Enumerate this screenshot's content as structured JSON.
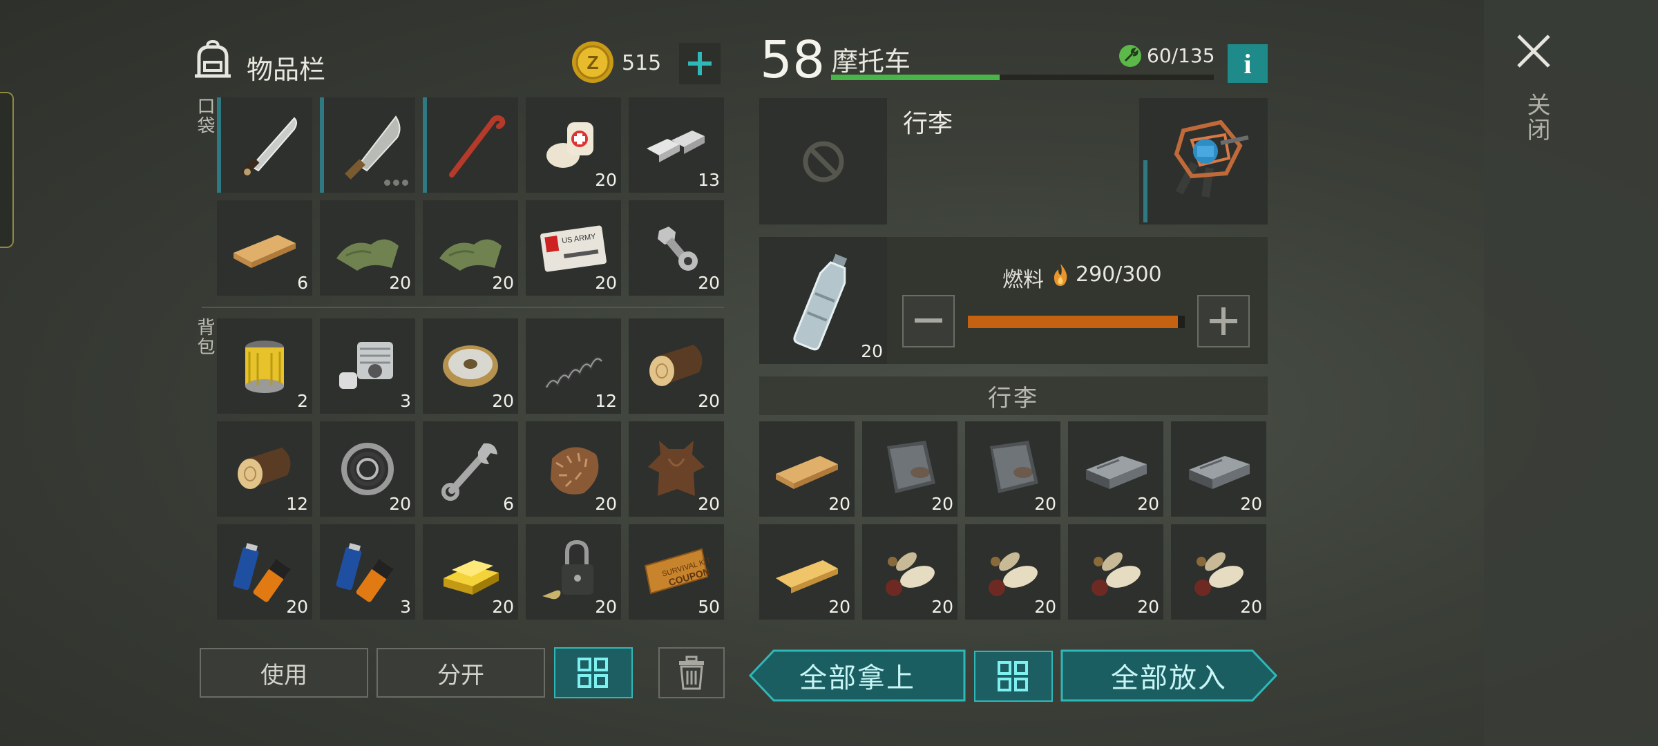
{
  "inventory": {
    "title": "物品栏",
    "coins": "515",
    "pockets_label": "口袋",
    "backpack_label": "背包",
    "pockets": [
      {
        "icon": "machete-icon",
        "count": "",
        "blue": true
      },
      {
        "icon": "broad-machete-icon",
        "count": "",
        "blue": true,
        "dots": true
      },
      {
        "icon": "crowbar-icon",
        "count": "",
        "blue": true
      },
      {
        "icon": "bandage-icon",
        "count": "20"
      },
      {
        "icon": "iron-bars-icon",
        "count": "13"
      },
      {
        "icon": "wooden-plank-icon",
        "count": "6"
      },
      {
        "icon": "cloth-icon",
        "count": "20"
      },
      {
        "icon": "cloth-icon",
        "count": "20"
      },
      {
        "icon": "us-army-card-icon",
        "count": "20"
      },
      {
        "icon": "bolt-nut-icon",
        "count": "20"
      }
    ],
    "backpack": [
      {
        "icon": "oil-filter-icon",
        "count": "2"
      },
      {
        "icon": "engine-cylinder-icon",
        "count": "3"
      },
      {
        "icon": "wire-spool-icon",
        "count": "20"
      },
      {
        "icon": "spring-icon",
        "count": "12"
      },
      {
        "icon": "log-icon",
        "count": "20"
      },
      {
        "icon": "log-icon",
        "count": "12"
      },
      {
        "icon": "bearing-icon",
        "count": "20"
      },
      {
        "icon": "wrench-icon",
        "count": "6"
      },
      {
        "icon": "fur-icon",
        "count": "20"
      },
      {
        "icon": "hide-icon",
        "count": "20"
      },
      {
        "icon": "batteries-icon",
        "count": "20"
      },
      {
        "icon": "batteries-icon",
        "count": "3"
      },
      {
        "icon": "gold-bar-icon",
        "count": "20"
      },
      {
        "icon": "padlock-icon",
        "count": "20"
      },
      {
        "icon": "coupon-icon",
        "count": "50"
      }
    ],
    "use_label": "使用",
    "split_label": "分开"
  },
  "vehicle": {
    "level": "58",
    "name": "摩托车",
    "durability": "60/135",
    "durability_fraction": 0.44,
    "info_label": "i",
    "slot_label": "行李",
    "fuel_label": "燃料",
    "fuel_value": "290/300",
    "fuel_fraction": 0.967,
    "fuel_item_count": "20",
    "cargo_header": "行李",
    "cargo": [
      {
        "icon": "wooden-plank-icon",
        "count": "20"
      },
      {
        "icon": "iron-sheet-icon",
        "count": "20"
      },
      {
        "icon": "iron-sheet-icon",
        "count": "20"
      },
      {
        "icon": "steel-ingot-icon",
        "count": "20"
      },
      {
        "icon": "steel-ingot-icon",
        "count": "20"
      },
      {
        "icon": "pine-plank-icon",
        "count": "20"
      },
      {
        "icon": "seeds-icon",
        "count": "20"
      },
      {
        "icon": "seeds-icon",
        "count": "20"
      },
      {
        "icon": "seeds-icon",
        "count": "20"
      },
      {
        "icon": "seeds-icon",
        "count": "20"
      }
    ],
    "take_all_label": "全部拿上",
    "put_all_label": "全部放入"
  },
  "close_label": "关闭",
  "colors": {
    "teal": "#2fb8b8",
    "health_green": "#49b548",
    "fuel_orange": "#c46212"
  }
}
